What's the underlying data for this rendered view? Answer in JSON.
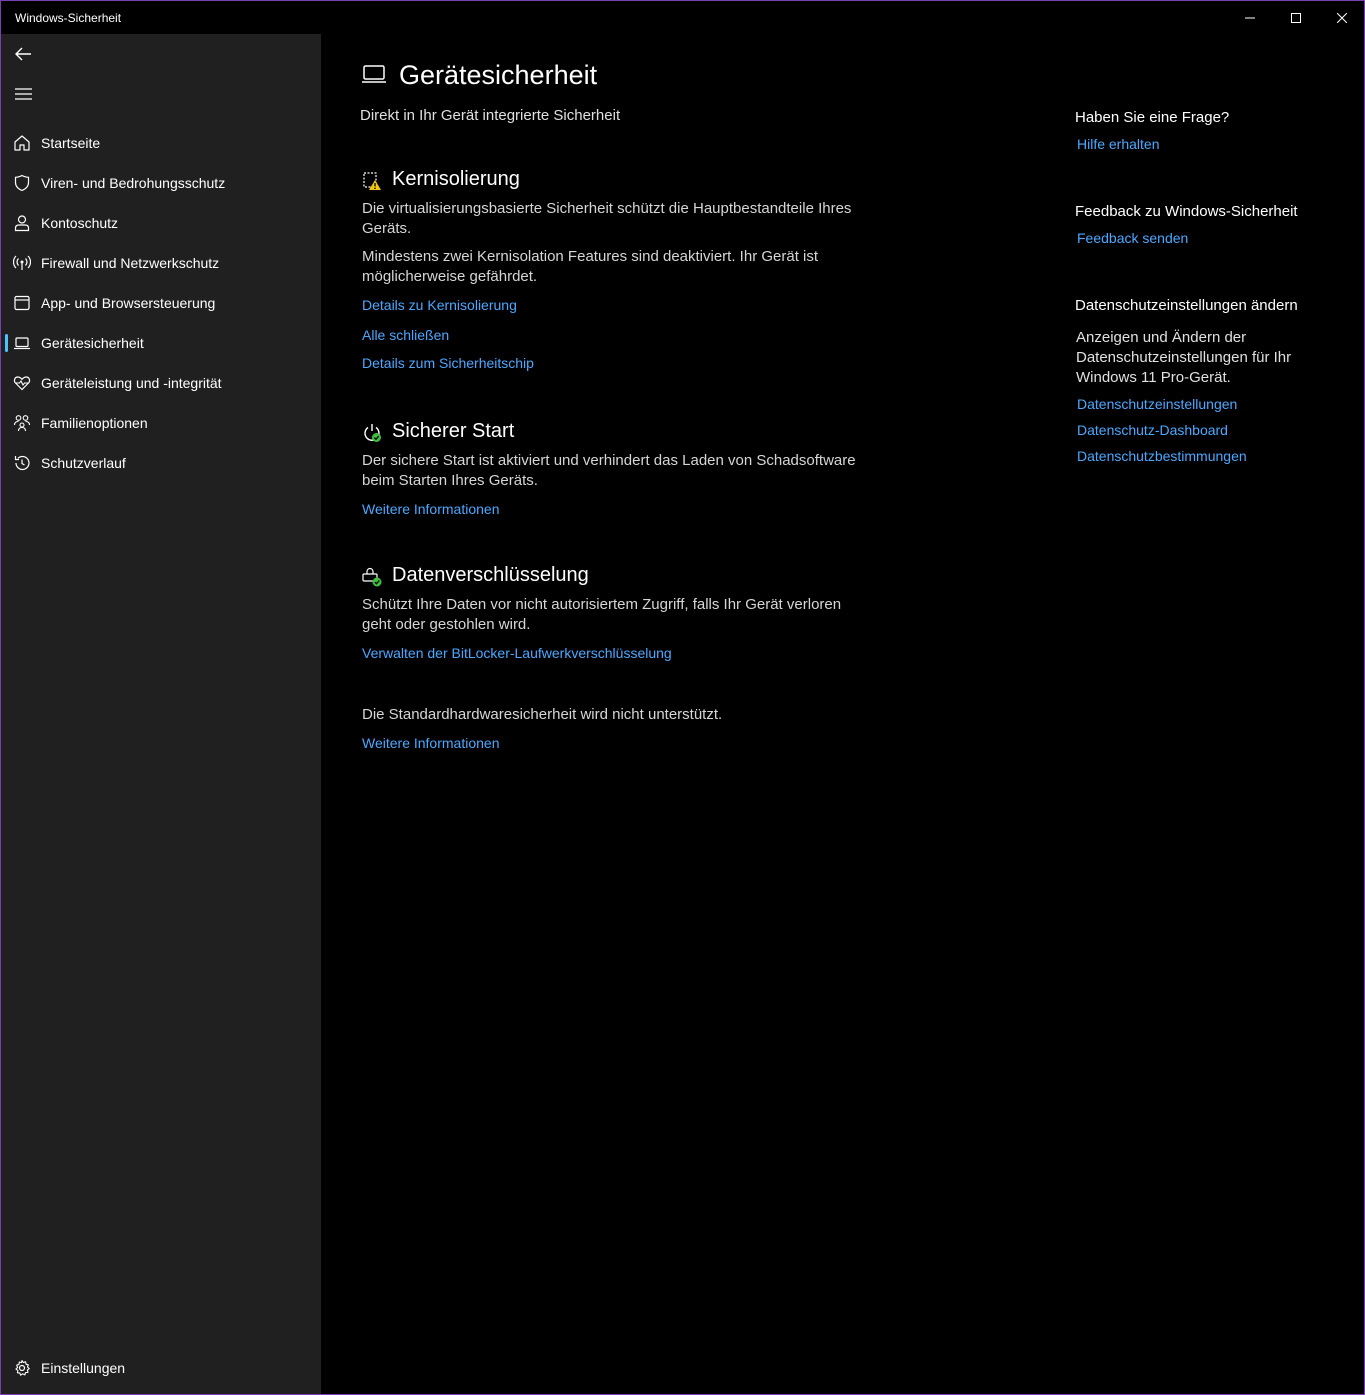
{
  "window": {
    "title": "Windows-Sicherheit",
    "controls": {
      "minimize": "minimize-icon",
      "maximize": "maximize-icon",
      "close": "close-icon"
    }
  },
  "sidebar": {
    "back_icon": "back-arrow-icon",
    "menu_icon": "hamburger-menu-icon",
    "items": [
      {
        "label": "Startseite",
        "icon": "home-icon"
      },
      {
        "label": "Viren- und Bedrohungsschutz",
        "icon": "shield-icon"
      },
      {
        "label": "Kontoschutz",
        "icon": "person-icon"
      },
      {
        "label": "Firewall und Netzwerkschutz",
        "icon": "wireless-signal-icon"
      },
      {
        "label": "App- und Browsersteuerung",
        "icon": "browser-window-icon"
      },
      {
        "label": "Gerätesicherheit",
        "icon": "laptop-icon",
        "active": true
      },
      {
        "label": "Geräteleistung und -integrität",
        "icon": "heart-pulse-icon"
      },
      {
        "label": "Familienoptionen",
        "icon": "family-icon"
      },
      {
        "label": "Schutzverlauf",
        "icon": "history-icon"
      }
    ],
    "settings": {
      "label": "Einstellungen",
      "icon": "gear-icon"
    }
  },
  "main": {
    "title": "Gerätesicherheit",
    "subtitle": "Direkt in Ihr Gerät integrierte Sicherheit",
    "core_isolation": {
      "heading": "Kernisolierung",
      "text1": "Die virtualisierungsbasierte Sicherheit schützt die Hauptbestandteile Ihres Geräts.",
      "text2": "Mindestens zwei Kernisolation Features sind deaktiviert. Ihr Gerät ist möglicherweise gefährdet.",
      "link_details": "Details zu Kernisolierung",
      "link_dismiss": "Alle schließen",
      "link_chip": "Details zum Sicherheitschip"
    },
    "secure_boot": {
      "heading": "Sicherer Start",
      "text": "Der sichere Start ist aktiviert und verhindert das Laden von Schadsoftware beim Starten Ihres Geräts.",
      "link": "Weitere Informationen"
    },
    "encryption": {
      "heading": "Datenverschlüsselung",
      "text": "Schützt Ihre Daten vor nicht autorisiertem Zugriff, falls Ihr Gerät verloren geht oder gestohlen wird.",
      "link": "Verwalten der BitLocker-Laufwerkverschlüsselung"
    },
    "hardware": {
      "text": "Die Standardhardwaresicherheit wird nicht unterstützt.",
      "link": "Weitere Informationen"
    }
  },
  "right": {
    "question_heading": "Haben Sie eine Frage?",
    "question_link": "Hilfe erhalten",
    "feedback_heading": "Feedback zu Windows-Sicherheit",
    "feedback_link": "Feedback senden",
    "privacy_heading": "Datenschutzeinstellungen ändern",
    "privacy_text": "Anzeigen und Ändern der Datenschutzeinstellungen für Ihr Windows 11 Pro-Gerät.",
    "privacy_links": [
      "Datenschutzeinstellungen",
      "Datenschutz-Dashboard",
      "Datenschutzbestimmungen"
    ]
  },
  "colors": {
    "accent": "#4cc2ff",
    "link": "#4ca8ff",
    "warning": "#f2c811",
    "ok": "#3fbf3f",
    "sidebar_bg": "#202020"
  }
}
